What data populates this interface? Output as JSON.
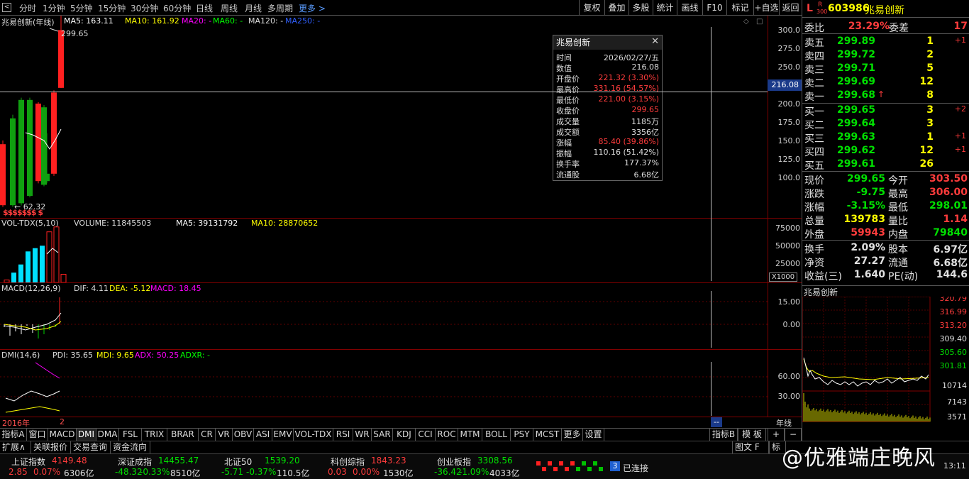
{
  "toolbar": {
    "back_icon": "back-square-icon",
    "timeframes": [
      "分时",
      "1分钟",
      "5分钟",
      "15分钟",
      "30分钟",
      "60分钟",
      "日线",
      "周线",
      "月线",
      "多周期"
    ],
    "more": "更多",
    "more_icon": "chevron-right-icon",
    "buttons": [
      "复权",
      "叠加",
      "多股",
      "统计",
      "画线",
      "F10",
      "标记",
      "+自选",
      "返回"
    ]
  },
  "main_chart": {
    "label": "兆易创新(年线)",
    "ma": [
      {
        "text": "MA5: 163.11",
        "color": "#ffffff"
      },
      {
        "text": "MA10: 161.92",
        "color": "#ffff00"
      },
      {
        "text": "MA20: -",
        "color": "#ff00ff"
      },
      {
        "text": "MA60: -",
        "color": "#00ff00"
      },
      {
        "text": "MA120: -",
        "color": "#dddddd"
      },
      {
        "text": "MA250: -",
        "color": "#3060ff"
      }
    ],
    "high_label": "299.65",
    "low_label": "62.32",
    "s_marks": "$$$$$$$  $",
    "cursor_value": "216.08",
    "yticks": [
      "300.0",
      "275.0",
      "250.0",
      "225.0",
      "200.0",
      "175.0",
      "150.0",
      "125.0",
      "100.0"
    ],
    "candles": [
      {
        "open": 145,
        "close": 62.32,
        "high": 150,
        "low": 60,
        "color": "red"
      },
      {
        "open": 180,
        "close": 62.32,
        "high": 185,
        "low": 60,
        "color": "green"
      },
      {
        "open": 205,
        "close": 65,
        "high": 208,
        "low": 62,
        "color": "green"
      },
      {
        "open": 205,
        "close": 75,
        "high": 208,
        "low": 73,
        "color": "green"
      },
      {
        "open": 200,
        "close": 95,
        "high": 202,
        "low": 92,
        "color": "red"
      },
      {
        "open": 195,
        "close": 90,
        "high": 198,
        "low": 88,
        "color": "green"
      },
      {
        "open": 105,
        "close": 95,
        "high": 160,
        "low": 92,
        "color": "green"
      },
      {
        "open": 105,
        "close": 215,
        "high": 218,
        "low": 102,
        "color": "red"
      },
      {
        "open": 221.32,
        "close": 299.65,
        "high": 331.16,
        "low": 221,
        "color": "red"
      }
    ]
  },
  "popup": {
    "title": "兆易创新",
    "close_icon": "close-icon",
    "rows": [
      {
        "k": "时间",
        "v": "2026/02/27/五",
        "color": "#dddddd"
      },
      {
        "k": "数值",
        "v": "216.08",
        "color": "#dddddd"
      },
      {
        "k": "开盘价",
        "v": "221.32 (3.30%)",
        "color": "#ff3c3c"
      },
      {
        "k": "最高价",
        "v": "331.16 (54.57%)",
        "color": "#ff3c3c"
      },
      {
        "k": "最低价",
        "v": "221.00 (3.15%)",
        "color": "#ff3c3c"
      },
      {
        "k": "收盘价",
        "v": "299.65",
        "color": "#ff3c3c"
      },
      {
        "k": "成交量",
        "v": "1185万",
        "color": "#dddddd"
      },
      {
        "k": "成交额",
        "v": "3356亿",
        "color": "#dddddd"
      },
      {
        "k": "涨幅",
        "v": "85.40 (39.86%)",
        "color": "#ff3c3c"
      },
      {
        "k": "振幅",
        "v": "110.16 (51.42%)",
        "color": "#dddddd"
      },
      {
        "k": "换手率",
        "v": "177.37%",
        "color": "#dddddd"
      },
      {
        "k": "流通股",
        "v": "6.68亿",
        "color": "#dddddd"
      }
    ]
  },
  "volume": {
    "label": "VOL-TDX(5,10)",
    "values": [
      {
        "text": "VOLUME: 11845503",
        "color": "#dddddd"
      },
      {
        "text": "MA5: 39131792",
        "color": "#ffffff"
      },
      {
        "text": "MA10: 28870652",
        "color": "#ffff00"
      }
    ],
    "yticks": [
      "75000",
      "50000",
      "25000"
    ],
    "unit": "X1000",
    "bars": [
      {
        "v": 3,
        "c": "red"
      },
      {
        "v": 12,
        "c": "cyan"
      },
      {
        "v": 22,
        "c": "cyan"
      },
      {
        "v": 38,
        "c": "cyan"
      },
      {
        "v": 42,
        "c": "cyan"
      },
      {
        "v": 45,
        "c": "cyan"
      },
      {
        "v": 62,
        "c": "red"
      },
      {
        "v": 68,
        "c": "red"
      },
      {
        "v": 10,
        "c": "red"
      }
    ]
  },
  "macd": {
    "label": "MACD(12,26,9)",
    "values": [
      {
        "text": "DIF: 4.11",
        "color": "#dddddd"
      },
      {
        "text": "DEA: -5.12",
        "color": "#ffff00"
      },
      {
        "text": "MACD: 18.45",
        "color": "#ff00ff"
      }
    ],
    "yticks": [
      "15.00",
      "0.00"
    ]
  },
  "dmi": {
    "label": "DMI(14,6)",
    "values": [
      {
        "text": "PDI: 35.65",
        "color": "#dddddd"
      },
      {
        "text": "MDI: 9.65",
        "color": "#ffff00"
      },
      {
        "text": "ADX: 50.25",
        "color": "#ff00ff"
      },
      {
        "text": "ADXR: -",
        "color": "#00ff00"
      }
    ],
    "yticks": [
      "60.00",
      "30.00"
    ]
  },
  "time_axis": {
    "left": "2016年",
    "mid": "2",
    "right_box": "--",
    "period": "年线"
  },
  "indicator_tabs": [
    "指标A",
    "窗口",
    "MACD",
    "DMI",
    "DMA",
    "FSL",
    "TRIX",
    "BRAR",
    "CR",
    "VR",
    "OBV",
    "ASI",
    "EMV",
    "VOL-TDX",
    "RSI",
    "WR",
    "SAR",
    "KDJ",
    "CCI",
    "ROC",
    "MTM",
    "BOLL",
    "PSY",
    "MCST",
    "更多",
    "设置"
  ],
  "right_tabs": [
    "指标B",
    "模 板",
    "+",
    "−"
  ],
  "quote": {
    "tag_l": "L",
    "tag_r": "R",
    "tag_300": "300",
    "code": "603986",
    "name": "兆易创新",
    "webi": {
      "k": "委比",
      "v": "23.29%",
      "k2": "委差",
      "v2": "17"
    },
    "asks": [
      {
        "k": "卖五",
        "p": "299.89",
        "q": "1",
        "d": "+1"
      },
      {
        "k": "卖四",
        "p": "299.72",
        "q": "2",
        "d": ""
      },
      {
        "k": "卖三",
        "p": "299.71",
        "q": "5",
        "d": ""
      },
      {
        "k": "卖二",
        "p": "299.69",
        "q": "12",
        "d": ""
      },
      {
        "k": "卖一",
        "p": "299.68",
        "q": "8",
        "d": ""
      }
    ],
    "ask1_arrow": "↑",
    "bids": [
      {
        "k": "买一",
        "p": "299.65",
        "q": "3",
        "d": "+2"
      },
      {
        "k": "买二",
        "p": "299.64",
        "q": "3",
        "d": ""
      },
      {
        "k": "买三",
        "p": "299.63",
        "q": "1",
        "d": "+1"
      },
      {
        "k": "买四",
        "p": "299.62",
        "q": "12",
        "d": "+1"
      },
      {
        "k": "买五",
        "p": "299.61",
        "q": "26",
        "d": ""
      }
    ],
    "stats": [
      {
        "k": "现价",
        "v": "299.65",
        "vc": "grn",
        "k2": "今开",
        "v2": "303.50",
        "v2c": "red"
      },
      {
        "k": "涨跌",
        "v": "-9.75",
        "vc": "grn",
        "k2": "最高",
        "v2": "306.00",
        "v2c": "red"
      },
      {
        "k": "涨幅",
        "v": "-3.15%",
        "vc": "grn",
        "k2": "最低",
        "v2": "298.01",
        "v2c": "grn"
      },
      {
        "k": "总量",
        "v": "139783",
        "vc": "yel",
        "k2": "量比",
        "v2": "1.14",
        "v2c": "red"
      },
      {
        "k": "外盘",
        "v": "59943",
        "vc": "red",
        "k2": "内盘",
        "v2": "79840",
        "v2c": "grn"
      },
      {
        "k": "换手",
        "v": "2.09%",
        "vc": "wht",
        "k2": "股本",
        "v2": "6.97亿",
        "v2c": "wht"
      },
      {
        "k": "净资",
        "v": "27.27",
        "vc": "wht",
        "k2": "流通",
        "v2": "6.68亿",
        "v2c": "wht"
      },
      {
        "k": "收益(三)",
        "v": "1.640",
        "vc": "wht",
        "k2": "PE(动)",
        "v2": "144.6",
        "v2c": "wht"
      }
    ]
  },
  "minichart": {
    "title": "兆易创新",
    "yticks": [
      "320.79",
      "316.99",
      "313.20",
      "309.40",
      "305.60",
      "301.81"
    ],
    "vticks": [
      "10714",
      "7143",
      "3571"
    ]
  },
  "bottom_tabs": [
    "扩展∧",
    "关联报价",
    "交易查询",
    "资金流向"
  ],
  "bottom_right": [
    "图文 F",
    "标"
  ],
  "indices": [
    {
      "name": "上证指数",
      "value": "4149.48",
      "chg": "2.85",
      "pct": "0.07%",
      "amt": "6306亿",
      "color": "#ff3c3c"
    },
    {
      "name": "深证成指",
      "value": "14455.47",
      "chg": "-48.32",
      "pct": "-0.33%",
      "amt": "8510亿",
      "color": "#00e000"
    },
    {
      "name": "北证50",
      "value": "1539.20",
      "chg": "-5.71",
      "pct": "-0.37%",
      "amt": "110.5亿",
      "color": "#00e000"
    },
    {
      "name": "科创综指",
      "value": "1843.23",
      "chg": "0.03",
      "pct": "0.00%",
      "amt": "1530亿",
      "color": "#ff3c3c"
    },
    {
      "name": "创业板指",
      "value": "3308.56",
      "chg": "-36.42",
      "pct": "-1.09%",
      "amt": "4033亿",
      "color": "#00e000"
    }
  ],
  "connection": {
    "count": "3",
    "text": "已连接"
  },
  "clock": "13:11",
  "watermark": "@优雅端庄晚风"
}
